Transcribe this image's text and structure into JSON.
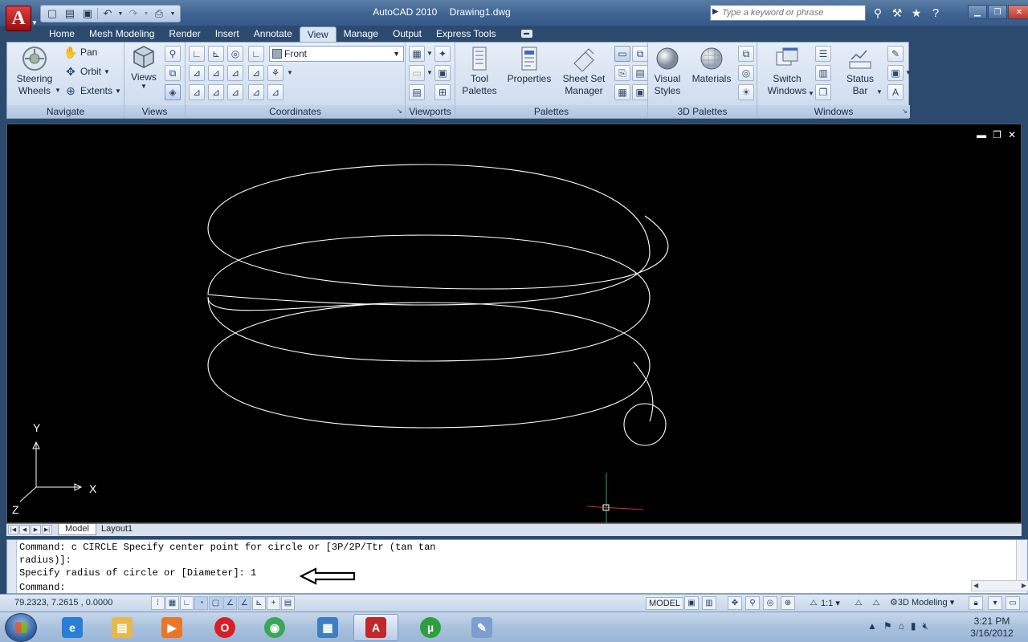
{
  "title_bar": {
    "app_name": "AutoCAD 2010",
    "file_name": "Drawing1.dwg",
    "search_placeholder": "Type a keyword or phrase",
    "app_logo": "A"
  },
  "ribbon_tabs": [
    {
      "label": "Home"
    },
    {
      "label": "Mesh Modeling"
    },
    {
      "label": "Render"
    },
    {
      "label": "Insert"
    },
    {
      "label": "Annotate"
    },
    {
      "label": "View",
      "active": true
    },
    {
      "label": "Manage"
    },
    {
      "label": "Output"
    },
    {
      "label": "Express Tools"
    }
  ],
  "ribbon": {
    "navigate": {
      "title": "Navigate",
      "steering_wheels": "Steering\nWheels",
      "pan": "Pan",
      "orbit": "Orbit",
      "extents": "Extents"
    },
    "views": {
      "title": "Views",
      "views_btn": "Views"
    },
    "coordinates": {
      "title": "Coordinates",
      "view_select": "Front"
    },
    "viewports": {
      "title": "Viewports"
    },
    "palettes": {
      "title": "Palettes",
      "tool_palettes": "Tool\nPalettes",
      "properties": "Properties",
      "sheet_set_manager": "Sheet Set\nManager"
    },
    "palettes_3d": {
      "title": "3D Palettes",
      "visual_styles": "Visual\nStyles",
      "materials": "Materials"
    },
    "windows": {
      "title": "Windows",
      "switch_windows": "Switch\nWindows",
      "status_bar": "Status\nBar"
    }
  },
  "drawing": {
    "background": "#000000",
    "ucs": {
      "y_label": "Y",
      "x_label": "X",
      "z_label": "Z"
    }
  },
  "layout_tabs": [
    {
      "label": "Model",
      "active": true
    },
    {
      "label": "Layout1"
    }
  ],
  "command": {
    "history": [
      "Command: c CIRCLE Specify center point for circle or [3P/2P/Ttr (tan tan",
      "radius)]:",
      "Specify radius of circle or [Diameter]: 1"
    ],
    "prompt": "Command:"
  },
  "status_bar": {
    "coordinates": "79.2323, 7.2615 , 0.0000",
    "model": "MODEL",
    "annotation_scale": "1:1",
    "workspace": "3D Modeling"
  },
  "taskbar": {
    "apps": [
      {
        "name": "internet-explorer",
        "glyph": "e",
        "color": "#2a7fd4"
      },
      {
        "name": "file-explorer",
        "glyph": "▤",
        "color": "#e8b84a"
      },
      {
        "name": "media-player",
        "glyph": "▶",
        "color": "#e8772a"
      },
      {
        "name": "opera",
        "glyph": "O",
        "color": "#d81f26"
      },
      {
        "name": "chrome",
        "glyph": "◉",
        "color": "#3aa757"
      },
      {
        "name": "photo-viewer",
        "glyph": "▦",
        "color": "#3f7fbf"
      },
      {
        "name": "autocad",
        "glyph": "A",
        "color": "#c0282c",
        "active": true
      },
      {
        "name": "utorrent",
        "glyph": "µ",
        "color": "#2e9e3e"
      },
      {
        "name": "paint",
        "glyph": "✎",
        "color": "#7a9fd0"
      }
    ],
    "time": "3:21 PM",
    "date": "3/16/2012"
  }
}
